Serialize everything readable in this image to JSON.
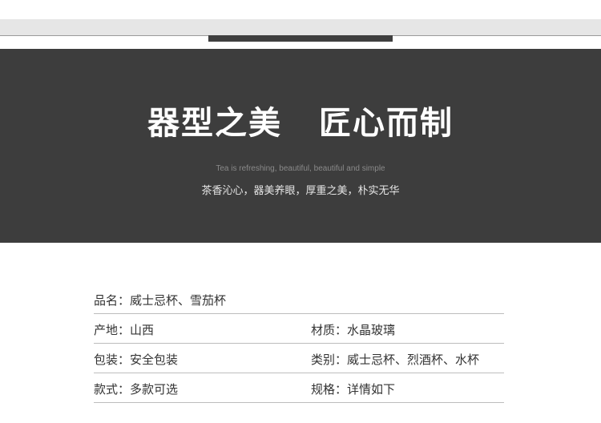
{
  "banner": {
    "headline_left": "器型之美",
    "headline_right": "匠心而制",
    "tagline_en": "Tea is refreshing, beautiful, beautiful and simple",
    "tagline_cn": "茶香沁心，器美养眼，厚重之美，朴实无华"
  },
  "specs": {
    "row1": {
      "c1": "品名：威士忌杯、雪茄杯"
    },
    "row2": {
      "c1": "产地：山西",
      "c2": "材质：水晶玻璃"
    },
    "row3": {
      "c1": "包装：安全包装",
      "c2": "类别：威士忌杯、烈酒杯、水杯"
    },
    "row4": {
      "c1": "款式：多款可选",
      "c2": "规格：详情如下"
    }
  },
  "colors": {
    "banner_bg": "#3d3d3d",
    "top_strip": "#e6e6e6",
    "divider": "#bdbdbd"
  }
}
